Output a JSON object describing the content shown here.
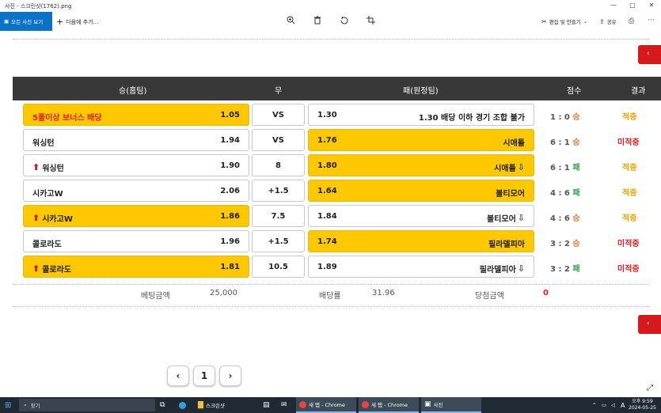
{
  "window": {
    "title": "사진 - 스크린샷(1762).png",
    "controls": [
      "—",
      "▢",
      "✕"
    ]
  },
  "toolbar": {
    "all_photos_label": "모든 사진 보기",
    "add_to_label": "다음에 추가...",
    "edit_create_label": "편집 및 만들기",
    "share_label": "공유"
  },
  "table": {
    "headers": {
      "home": "승(홈팀)",
      "draw": "무",
      "away": "패(원정팀)",
      "score": "점수",
      "result": "결과"
    },
    "rows": [
      {
        "home_name": "5폴이상 보너스 배당",
        "home_odds": "1.05",
        "home_arrow": "",
        "home_selected": true,
        "home_red": true,
        "mid": "VS",
        "away_name": "1.30 배당 이하 경기 조합 불가",
        "away_odds": "1.30",
        "away_arrow": "",
        "away_selected": false,
        "score": "1 : 0",
        "outcome": "승",
        "outcome_type": "win",
        "result": "적중",
        "result_type": "hit"
      },
      {
        "home_name": "워싱턴",
        "home_odds": "1.94",
        "home_arrow": "",
        "home_selected": false,
        "home_red": false,
        "mid": "VS",
        "away_name": "시애틀",
        "away_odds": "1.76",
        "away_arrow": "",
        "away_selected": true,
        "score": "6 : 1",
        "outcome": "승",
        "outcome_type": "win",
        "result": "미적중",
        "result_type": "miss"
      },
      {
        "home_name": "워싱턴",
        "home_odds": "1.90",
        "home_arrow": "up",
        "home_selected": false,
        "home_red": false,
        "mid": "8",
        "away_name": "시애틀",
        "away_odds": "1.80",
        "away_arrow": "down",
        "away_selected": true,
        "score": "6 : 1",
        "outcome": "패",
        "outcome_type": "draw",
        "result": "적중",
        "result_type": "hit"
      },
      {
        "home_name": "시카고W",
        "home_odds": "2.06",
        "home_arrow": "",
        "home_selected": false,
        "home_red": false,
        "mid": "+1.5",
        "away_name": "볼티모어",
        "away_odds": "1.64",
        "away_arrow": "",
        "away_selected": true,
        "score": "4 : 6",
        "outcome": "패",
        "outcome_type": "draw",
        "result": "적중",
        "result_type": "hit"
      },
      {
        "home_name": "시카고W",
        "home_odds": "1.86",
        "home_arrow": "up",
        "home_selected": true,
        "home_red": false,
        "mid": "7.5",
        "away_name": "볼티모어",
        "away_odds": "1.84",
        "away_arrow": "down",
        "away_selected": false,
        "score": "4 : 6",
        "outcome": "승",
        "outcome_type": "win",
        "result": "적중",
        "result_type": "hit"
      },
      {
        "home_name": "콜로라도",
        "home_odds": "1.96",
        "home_arrow": "",
        "home_selected": false,
        "home_red": false,
        "mid": "+1.5",
        "away_name": "필라델피아",
        "away_odds": "1.74",
        "away_arrow": "",
        "away_selected": true,
        "score": "3 : 2",
        "outcome": "승",
        "outcome_type": "win",
        "result": "미적중",
        "result_type": "miss"
      },
      {
        "home_name": "콜로라도",
        "home_odds": "1.81",
        "home_arrow": "up",
        "home_selected": true,
        "home_red": false,
        "mid": "10.5",
        "away_name": "필라델피아",
        "away_odds": "1.89",
        "away_arrow": "down",
        "away_selected": false,
        "score": "3 : 2",
        "outcome": "패",
        "outcome_type": "draw",
        "result": "미적중",
        "result_type": "miss"
      }
    ]
  },
  "summary": {
    "bet_amount_label": "베팅금액",
    "bet_amount": "25,000",
    "odds_label": "배당률",
    "odds": "31.96",
    "win_amount_label": "당첨금액",
    "win_amount": "0"
  },
  "pagination": {
    "prev": "‹",
    "page": "1",
    "next": "›"
  },
  "taskbar": {
    "search_placeholder": "찾기",
    "items": [
      {
        "label": "스크린샷"
      },
      {
        "label": "새 탭 - Chrome"
      },
      {
        "label": "새 탭 - Chrome"
      },
      {
        "label": "사진"
      }
    ],
    "time": "오후 9:59",
    "date": "2024-05-25",
    "ime": "A"
  },
  "colors": {
    "accent": "#0a72c9",
    "highlight": "#ffc800",
    "header_bg": "#383838",
    "red_tab": "#d6191d"
  }
}
